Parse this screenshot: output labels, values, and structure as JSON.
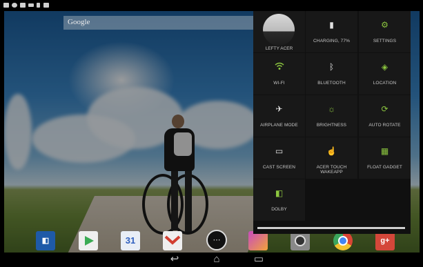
{
  "status_bar": {
    "icons": [
      "notification-icon",
      "usb-icon",
      "alert-icon",
      "menu-icon",
      "usb-debug-icon",
      "image-icon"
    ]
  },
  "home": {
    "search": {
      "placeholder": "Google"
    },
    "dock": [
      {
        "name": "dolby-app-icon",
        "color": "#1e5aa8"
      },
      {
        "name": "play-store-icon",
        "color": "#f2f2f2"
      },
      {
        "name": "calendar-icon",
        "color": "#3c6fd1",
        "text": "31"
      },
      {
        "name": "gmail-icon",
        "color": "#e8e8e8"
      },
      {
        "name": "gallery-icon",
        "color": "#8a3aa8"
      },
      {
        "name": "camera-icon",
        "color": "#7a7a7a"
      },
      {
        "name": "chrome-icon",
        "color": "#d94535"
      },
      {
        "name": "google-plus-icon",
        "color": "#d4473a",
        "text": "g+"
      }
    ],
    "apps_glyph": "⋯"
  },
  "quick_settings": {
    "user": {
      "label": "LEFTY ACER"
    },
    "tiles": [
      {
        "id": "battery",
        "label": "CHARGING, 77%",
        "icon": "battery-charging-icon"
      },
      {
        "id": "settings",
        "label": "SETTINGS",
        "icon": "gear-icon"
      },
      {
        "id": "wifi",
        "label": "WI-FI",
        "icon": "wifi-icon"
      },
      {
        "id": "bluetooth",
        "label": "BLUETOOTH",
        "icon": "bluetooth-icon"
      },
      {
        "id": "location",
        "label": "LOCATION",
        "icon": "location-icon"
      },
      {
        "id": "airplane",
        "label": "AIRPLANE MODE",
        "icon": "airplane-icon"
      },
      {
        "id": "brightness",
        "label": "BRIGHTNESS",
        "icon": "brightness-icon"
      },
      {
        "id": "autorotate",
        "label": "AUTO ROTATE",
        "icon": "rotate-icon"
      },
      {
        "id": "cast",
        "label": "CAST SCREEN",
        "icon": "cast-icon"
      },
      {
        "id": "touch",
        "label": "ACER TOUCH WAKEAPP",
        "icon": "hand-touch-icon"
      },
      {
        "id": "float",
        "label": "FLOAT GADGET",
        "icon": "float-gadget-icon"
      },
      {
        "id": "dolby",
        "label": "DOLBY",
        "icon": "dolby-icon"
      }
    ]
  },
  "navigation": {
    "back_glyph": "↩",
    "home_glyph": "⌂",
    "recents_glyph": "▭"
  },
  "colors": {
    "accent_green": "#8cc63f",
    "panel_bg": "#101010",
    "tile_bg": "#181818"
  }
}
